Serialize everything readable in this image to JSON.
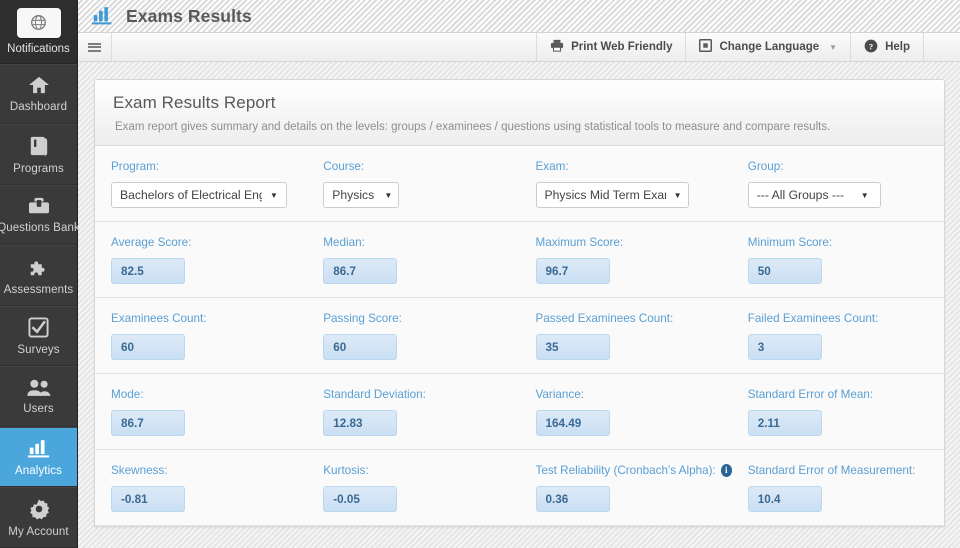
{
  "sidebar": {
    "notifications": {
      "label": "Notifications",
      "icon": "globe-icon"
    },
    "items": [
      {
        "label": "Dashboard",
        "icon": "home-icon",
        "active": false
      },
      {
        "label": "Programs",
        "icon": "book-icon",
        "active": false
      },
      {
        "label": "Questions Bank",
        "icon": "toolbox-icon",
        "active": false
      },
      {
        "label": "Assessments",
        "icon": "puzzle-icon",
        "active": false
      },
      {
        "label": "Surveys",
        "icon": "checkbox-icon",
        "active": false
      },
      {
        "label": "Users",
        "icon": "users-icon",
        "active": false
      },
      {
        "label": "Analytics",
        "icon": "bar-chart-icon",
        "active": true
      },
      {
        "label": "My Account",
        "icon": "gear-icon",
        "active": false
      }
    ]
  },
  "header": {
    "title": "Exams Results",
    "logo_icon": "bar-chart-icon"
  },
  "toolbar": {
    "menu_icon": "hamburger-icon",
    "print_label": "Print Web Friendly",
    "print_icon": "printer-icon",
    "language_label": "Change Language",
    "language_icon": "window-icon",
    "language_caret": "▼",
    "help_label": "Help",
    "help_icon": "question-circle-icon"
  },
  "panel": {
    "title": "Exam Results Report",
    "subtitle": "Exam report gives summary and details on the levels: groups / examinees / questions using statistical tools to measure and compare results."
  },
  "filters": [
    {
      "label": "Program:",
      "value": "Bachelors of Electrical Engin",
      "name": "program-select"
    },
    {
      "label": "Course:",
      "value": "Physics I",
      "name": "course-select"
    },
    {
      "label": "Exam:",
      "value": "Physics Mid Term Exam",
      "name": "exam-select"
    },
    {
      "label": "Group:",
      "value": "--- All Groups ---",
      "name": "group-select"
    }
  ],
  "stats_rows": [
    [
      {
        "label": "Average Score:",
        "value": "82.5",
        "name": "average-score"
      },
      {
        "label": "Median:",
        "value": "86.7",
        "name": "median"
      },
      {
        "label": "Maximum Score:",
        "value": "96.7",
        "name": "maximum-score"
      },
      {
        "label": "Minimum Score:",
        "value": "50",
        "name": "minimum-score"
      }
    ],
    [
      {
        "label": "Examinees Count:",
        "value": "60",
        "name": "examinees-count"
      },
      {
        "label": "Passing Score:",
        "value": "60",
        "name": "passing-score"
      },
      {
        "label": "Passed Examinees Count:",
        "value": "35",
        "name": "passed-examinees-count"
      },
      {
        "label": "Failed Examinees Count:",
        "value": "3",
        "name": "failed-examinees-count"
      }
    ],
    [
      {
        "label": "Mode:",
        "value": "86.7",
        "name": "mode"
      },
      {
        "label": "Standard Deviation:",
        "value": "12.83",
        "name": "standard-deviation"
      },
      {
        "label": "Variance:",
        "value": "164.49",
        "name": "variance"
      },
      {
        "label": "Standard Error of Mean:",
        "value": "2.11",
        "name": "standard-error-of-mean"
      }
    ],
    [
      {
        "label": "Skewness:",
        "value": "-0.81",
        "name": "skewness"
      },
      {
        "label": "Kurtosis:",
        "value": "-0.05",
        "name": "kurtosis"
      },
      {
        "label": "Test Reliability (Cronbach's Alpha):",
        "value": "0.36",
        "name": "test-reliability",
        "info": "i"
      },
      {
        "label": "Standard Error of Measurement:",
        "value": "10.4",
        "name": "standard-error-of-measurement"
      }
    ]
  ],
  "colors": {
    "accent": "#4ba6dc",
    "label_blue": "#5a9fd4",
    "value_text": "#3a6a94",
    "sidebar_bg": "#3a3a3a"
  }
}
